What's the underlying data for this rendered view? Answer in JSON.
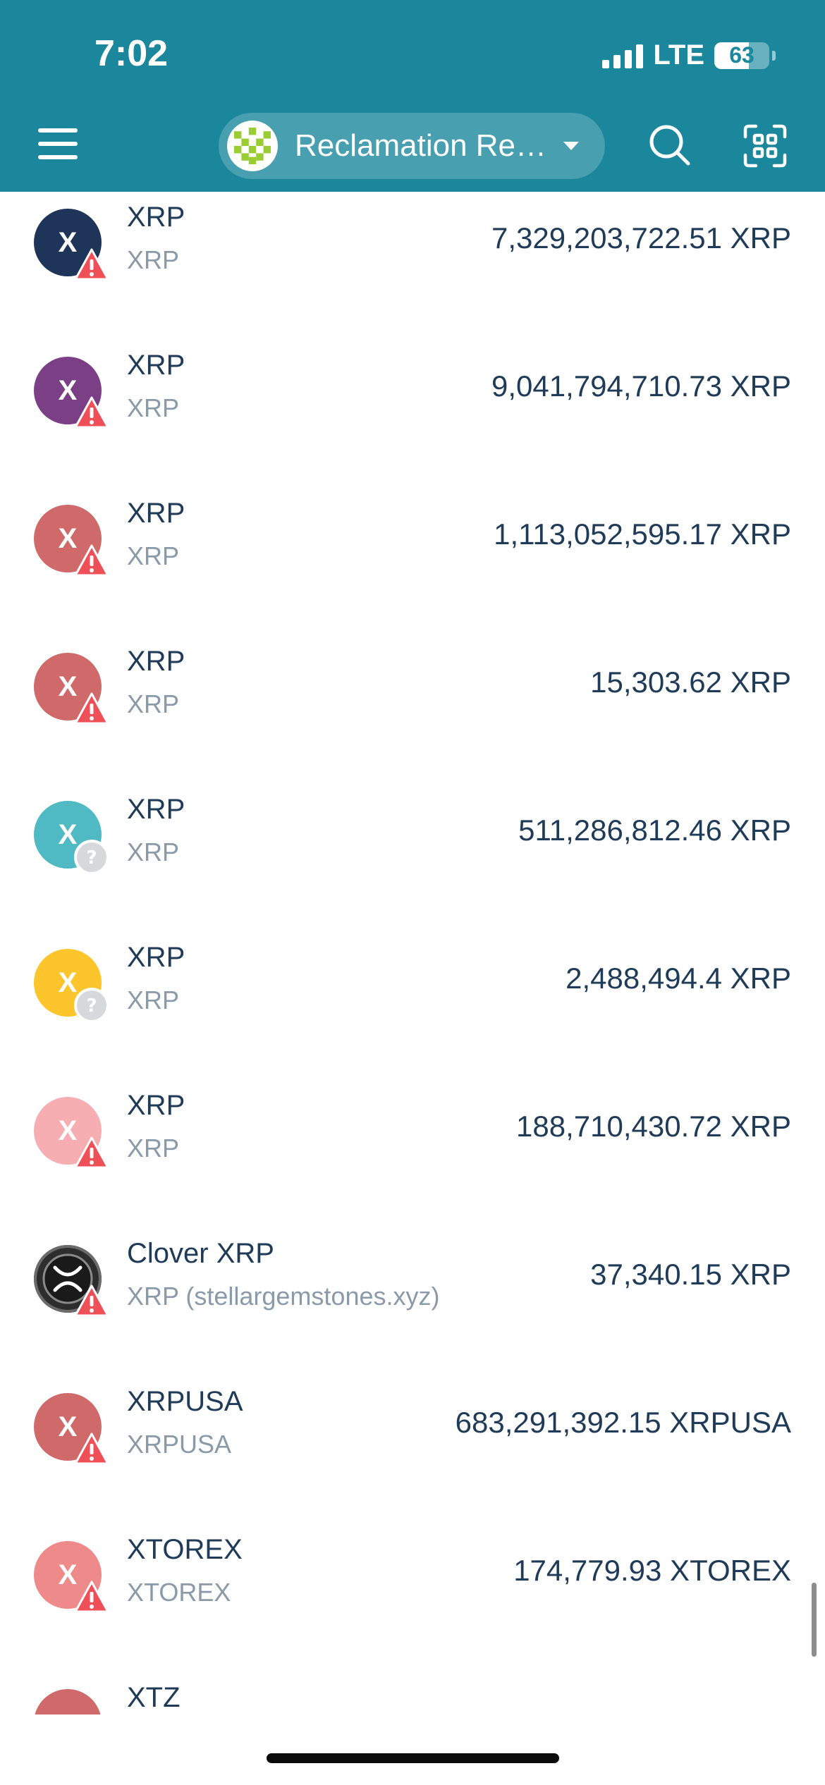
{
  "status_bar": {
    "time": "7:02",
    "network": "LTE",
    "battery": "63",
    "battery_level": 0.63
  },
  "header": {
    "account_name": "Reclamation Re…",
    "icons": {
      "menu": "hamburger-menu-icon",
      "dropdown": "chevron-down-icon",
      "search": "search-icon",
      "scan": "qr-scan-icon"
    }
  },
  "assets": [
    {
      "name": "XRP",
      "sub": "XRP",
      "amount": "7,329,203,722.51 XRP",
      "letter": "X",
      "color": "#1e3559",
      "badge": "warning"
    },
    {
      "name": "XRP",
      "sub": "XRP",
      "amount": "9,041,794,710.73 XRP",
      "letter": "X",
      "color": "#7b3f86",
      "badge": "warning"
    },
    {
      "name": "XRP",
      "sub": "XRP",
      "amount": "1,113,052,595.17 XRP",
      "letter": "X",
      "color": "#d06a6a",
      "badge": "warning"
    },
    {
      "name": "XRP",
      "sub": "XRP",
      "amount": "15,303.62 XRP",
      "letter": "X",
      "color": "#d06a6a",
      "badge": "warning"
    },
    {
      "name": "XRP",
      "sub": "XRP",
      "amount": "511,286,812.46 XRP",
      "letter": "X",
      "color": "#4fbac3",
      "badge": "unknown"
    },
    {
      "name": "XRP",
      "sub": "XRP",
      "amount": "2,488,494.4 XRP",
      "letter": "X",
      "color": "#fcc52b",
      "badge": "unknown"
    },
    {
      "name": "XRP",
      "sub": "XRP",
      "amount": "188,710,430.72 XRP",
      "letter": "X",
      "color": "#f6aeb2",
      "badge": "warning"
    },
    {
      "name": "Clover XRP",
      "sub": "XRP (stellargemstones.xyz)",
      "amount": "37,340.15 XRP",
      "letter": "",
      "color": "#2d2d2d",
      "badge": "warning",
      "logo": "xrp-logo"
    },
    {
      "name": "XRPUSA",
      "sub": "XRPUSA",
      "amount": "683,291,392.15 XRPUSA",
      "letter": "X",
      "color": "#d06a6a",
      "badge": "warning"
    },
    {
      "name": "XTOREX",
      "sub": "XTOREX",
      "amount": "174,779.93 XTOREX",
      "letter": "X",
      "color": "#ef8a8a",
      "badge": "warning"
    },
    {
      "name": "XTZ",
      "sub": "",
      "amount": "",
      "letter": "",
      "color": "#d06a6a",
      "badge": ""
    }
  ],
  "colors": {
    "header_bg": "#1a879c",
    "warning": "#ef5058",
    "unknown": "#d6d8db",
    "text_primary": "#1f3b57",
    "text_secondary": "#8a9aa8"
  }
}
